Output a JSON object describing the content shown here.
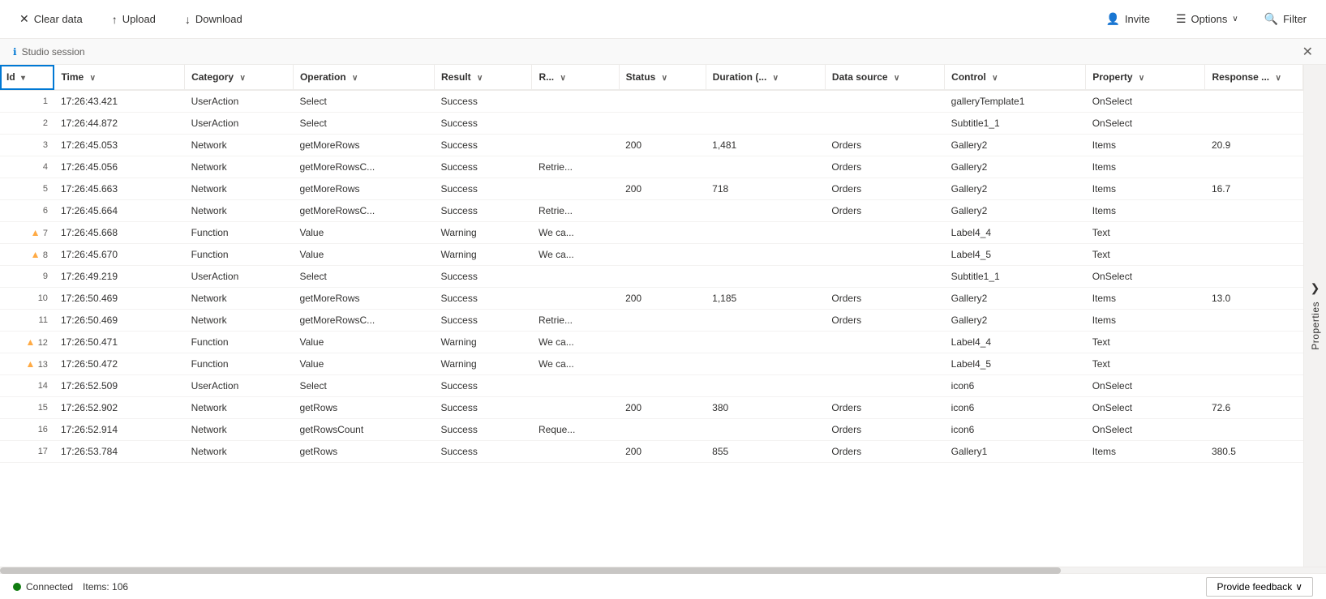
{
  "toolbar": {
    "clear_data_label": "Clear data",
    "upload_label": "Upload",
    "download_label": "Download",
    "invite_label": "Invite",
    "options_label": "Options",
    "filter_label": "Filter"
  },
  "session_bar": {
    "label": "Studio session"
  },
  "side_panel": {
    "label": "Properties",
    "arrow": "❯"
  },
  "columns": [
    {
      "key": "id",
      "label": "Id",
      "sort": "▾",
      "selected": true
    },
    {
      "key": "time",
      "label": "Time",
      "sort": "∨"
    },
    {
      "key": "category",
      "label": "Category",
      "sort": "∨"
    },
    {
      "key": "operation",
      "label": "Operation",
      "sort": "∨"
    },
    {
      "key": "result",
      "label": "Result",
      "sort": "∨"
    },
    {
      "key": "r",
      "label": "R...",
      "sort": "∨"
    },
    {
      "key": "status",
      "label": "Status",
      "sort": "∨"
    },
    {
      "key": "duration",
      "label": "Duration (...",
      "sort": "∨"
    },
    {
      "key": "datasource",
      "label": "Data source",
      "sort": "∨"
    },
    {
      "key": "control",
      "label": "Control",
      "sort": "∨"
    },
    {
      "key": "property",
      "label": "Property",
      "sort": "∨"
    },
    {
      "key": "response",
      "label": "Response ...",
      "sort": "∨"
    }
  ],
  "rows": [
    {
      "id": 1,
      "warn": false,
      "time": "17:26:43.421",
      "category": "UserAction",
      "operation": "Select",
      "result": "Success",
      "r": "",
      "status": "",
      "duration": "",
      "datasource": "",
      "control": "galleryTemplate1",
      "property": "OnSelect",
      "response": ""
    },
    {
      "id": 2,
      "warn": false,
      "time": "17:26:44.872",
      "category": "UserAction",
      "operation": "Select",
      "result": "Success",
      "r": "",
      "status": "",
      "duration": "",
      "datasource": "",
      "control": "Subtitle1_1",
      "property": "OnSelect",
      "response": ""
    },
    {
      "id": 3,
      "warn": false,
      "time": "17:26:45.053",
      "category": "Network",
      "operation": "getMoreRows",
      "result": "Success",
      "r": "",
      "status": "200",
      "duration": "1,481",
      "datasource": "Orders",
      "control": "Gallery2",
      "property": "Items",
      "response": "20.9"
    },
    {
      "id": 4,
      "warn": false,
      "time": "17:26:45.056",
      "category": "Network",
      "operation": "getMoreRowsC...",
      "result": "Success",
      "r": "Retrie...",
      "status": "",
      "duration": "",
      "datasource": "Orders",
      "control": "Gallery2",
      "property": "Items",
      "response": ""
    },
    {
      "id": 5,
      "warn": false,
      "time": "17:26:45.663",
      "category": "Network",
      "operation": "getMoreRows",
      "result": "Success",
      "r": "",
      "status": "200",
      "duration": "718",
      "datasource": "Orders",
      "control": "Gallery2",
      "property": "Items",
      "response": "16.7"
    },
    {
      "id": 6,
      "warn": false,
      "time": "17:26:45.664",
      "category": "Network",
      "operation": "getMoreRowsC...",
      "result": "Success",
      "r": "Retrie...",
      "status": "",
      "duration": "",
      "datasource": "Orders",
      "control": "Gallery2",
      "property": "Items",
      "response": ""
    },
    {
      "id": 7,
      "warn": true,
      "time": "17:26:45.668",
      "category": "Function",
      "operation": "Value",
      "result": "Warning",
      "r": "We ca...",
      "status": "",
      "duration": "",
      "datasource": "",
      "control": "Label4_4",
      "property": "Text",
      "response": ""
    },
    {
      "id": 8,
      "warn": true,
      "time": "17:26:45.670",
      "category": "Function",
      "operation": "Value",
      "result": "Warning",
      "r": "We ca...",
      "status": "",
      "duration": "",
      "datasource": "",
      "control": "Label4_5",
      "property": "Text",
      "response": ""
    },
    {
      "id": 9,
      "warn": false,
      "time": "17:26:49.219",
      "category": "UserAction",
      "operation": "Select",
      "result": "Success",
      "r": "",
      "status": "",
      "duration": "",
      "datasource": "",
      "control": "Subtitle1_1",
      "property": "OnSelect",
      "response": ""
    },
    {
      "id": 10,
      "warn": false,
      "time": "17:26:50.469",
      "category": "Network",
      "operation": "getMoreRows",
      "result": "Success",
      "r": "",
      "status": "200",
      "duration": "1,185",
      "datasource": "Orders",
      "control": "Gallery2",
      "property": "Items",
      "response": "13.0"
    },
    {
      "id": 11,
      "warn": false,
      "time": "17:26:50.469",
      "category": "Network",
      "operation": "getMoreRowsC...",
      "result": "Success",
      "r": "Retrie...",
      "status": "",
      "duration": "",
      "datasource": "Orders",
      "control": "Gallery2",
      "property": "Items",
      "response": ""
    },
    {
      "id": 12,
      "warn": true,
      "time": "17:26:50.471",
      "category": "Function",
      "operation": "Value",
      "result": "Warning",
      "r": "We ca...",
      "status": "",
      "duration": "",
      "datasource": "",
      "control": "Label4_4",
      "property": "Text",
      "response": ""
    },
    {
      "id": 13,
      "warn": true,
      "time": "17:26:50.472",
      "category": "Function",
      "operation": "Value",
      "result": "Warning",
      "r": "We ca...",
      "status": "",
      "duration": "",
      "datasource": "",
      "control": "Label4_5",
      "property": "Text",
      "response": ""
    },
    {
      "id": 14,
      "warn": false,
      "time": "17:26:52.509",
      "category": "UserAction",
      "operation": "Select",
      "result": "Success",
      "r": "",
      "status": "",
      "duration": "",
      "datasource": "",
      "control": "icon6",
      "property": "OnSelect",
      "response": ""
    },
    {
      "id": 15,
      "warn": false,
      "time": "17:26:52.902",
      "category": "Network",
      "operation": "getRows",
      "result": "Success",
      "r": "",
      "status": "200",
      "duration": "380",
      "datasource": "Orders",
      "control": "icon6",
      "property": "OnSelect",
      "response": "72.6"
    },
    {
      "id": 16,
      "warn": false,
      "time": "17:26:52.914",
      "category": "Network",
      "operation": "getRowsCount",
      "result": "Success",
      "r": "Reque...",
      "status": "",
      "duration": "",
      "datasource": "Orders",
      "control": "icon6",
      "property": "OnSelect",
      "response": ""
    },
    {
      "id": 17,
      "warn": false,
      "time": "17:26:53.784",
      "category": "Network",
      "operation": "getRows",
      "result": "Success",
      "r": "",
      "status": "200",
      "duration": "855",
      "datasource": "Orders",
      "control": "Gallery1",
      "property": "Items",
      "response": "380.5"
    }
  ],
  "status_bar": {
    "connected_label": "Connected",
    "items_label": "Items: 106"
  },
  "feedback_btn": {
    "label": "Provide feedback",
    "chevron": "∨"
  }
}
